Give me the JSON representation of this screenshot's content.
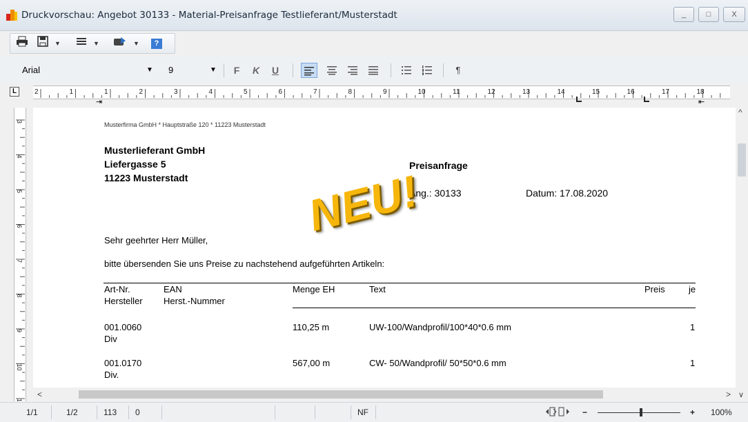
{
  "window": {
    "title": "Druckvorschau: Angebot 30133 - Material-Preisanfrage Testlieferant/Musterstadt",
    "controls": {
      "minimize": "_",
      "maximize": "□",
      "close": "X"
    }
  },
  "toolbar": {
    "icons": [
      "printer-icon",
      "save-icon",
      "list-icon",
      "export-icon",
      "help-icon"
    ],
    "help_label": "?"
  },
  "format_bar": {
    "font_name": "Arial",
    "font_size": "9",
    "bold": "F",
    "italic": "K",
    "underline": "U",
    "pilcrow": "¶"
  },
  "ruler": {
    "corner": "L",
    "h_labels": [
      "2",
      "1",
      "1",
      "2",
      "3",
      "4",
      "5",
      "6",
      "7",
      "8",
      "9",
      "10",
      "11",
      "12",
      "13",
      "14",
      "15",
      "16",
      "17",
      "18"
    ],
    "v_labels": [
      "3",
      "4",
      "5",
      "6",
      "7",
      "8",
      "9",
      "10",
      "11"
    ]
  },
  "document": {
    "sender_line": "Musterfirma GmbH * Hauptstraße 120 * 11223 Musterstadt",
    "recipient": [
      "Musterlieferant GmbH",
      "Liefergasse 5",
      "11223 Musterstadt"
    ],
    "doc_type": "Preisanfrage",
    "ang": "Ang.: 30133",
    "datum": "Datum: 17.08.2020",
    "stamp": "NEU!",
    "salutation": "Sehr geehrter Herr Müller,",
    "intro": "bitte übersenden Sie uns Preise zu nachstehend aufgeführten Artikeln:",
    "table_headers": {
      "art_nr": "Art-Nr.",
      "ean": "EAN",
      "hersteller": "Hersteller",
      "herst_nummer": "Herst.-Nummer",
      "menge_eh": "Menge EH",
      "text": "Text",
      "preis": "Preis",
      "je": "je"
    },
    "rows": [
      {
        "art_nr": "001.0060",
        "hersteller": "Div",
        "menge": "110,25 m",
        "text": "UW-100/Wandprofil/100*40*0.6 mm",
        "je": "1"
      },
      {
        "art_nr": "001.0170",
        "hersteller": "Div.",
        "menge": "567,00 m",
        "text": "CW- 50/Wandprofil/ 50*50*0.6 mm",
        "je": "1"
      }
    ]
  },
  "status": {
    "page": "1/1",
    "section": "1/2",
    "pos": "113",
    "col": "0",
    "nf": "NF",
    "zoom": "100%",
    "zoom_minus": "−",
    "zoom_plus": "+"
  }
}
